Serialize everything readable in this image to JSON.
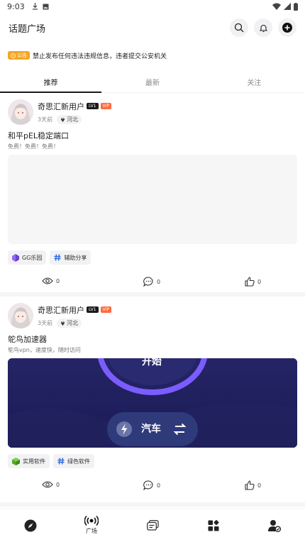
{
  "status_bar": {
    "time": "9:03"
  },
  "header": {
    "title": "话题广场"
  },
  "notice": {
    "badge": "公告",
    "text": "禁止发布任何违法违规信息，违者提交公安机关"
  },
  "tabs": [
    {
      "label": "推荐",
      "active": true
    },
    {
      "label": "最新",
      "active": false
    },
    {
      "label": "关注",
      "active": false
    }
  ],
  "posts": [
    {
      "author": "奇思汇新用户",
      "level": "LV1",
      "vip": "VIP",
      "time": "3天前",
      "location": "河北",
      "title": "和平pEL稳定端口",
      "desc": "免费！免费！免费！",
      "tags": [
        "GG乐园",
        "辅助分享"
      ],
      "views": "0",
      "comments": "0",
      "likes": "0"
    },
    {
      "author": "奇思汇新用户",
      "level": "LV1",
      "vip": "VIP",
      "time": "3天前",
      "location": "河北",
      "title": "鸵鸟加速器",
      "desc": "鸵鸟vpn，速度快，随时访问",
      "media_top_text": "开始",
      "media_mode_text": "汽车",
      "tags": [
        "实用软件",
        "绿色软件"
      ],
      "views": "0",
      "comments": "0",
      "likes": "0"
    }
  ],
  "bottom_nav": [
    {
      "icon": "compass-icon",
      "label": ""
    },
    {
      "icon": "broadcast-icon",
      "label": "广场"
    },
    {
      "icon": "messages-icon",
      "label": ""
    },
    {
      "icon": "apps-icon",
      "label": ""
    },
    {
      "icon": "user-icon",
      "label": ""
    }
  ],
  "colors": {
    "accent_orange": "#f5a623",
    "vip_orange": "#ff6a3d",
    "banner_blue": "#1f1f5e",
    "ring_purple": "#7b5cff"
  }
}
